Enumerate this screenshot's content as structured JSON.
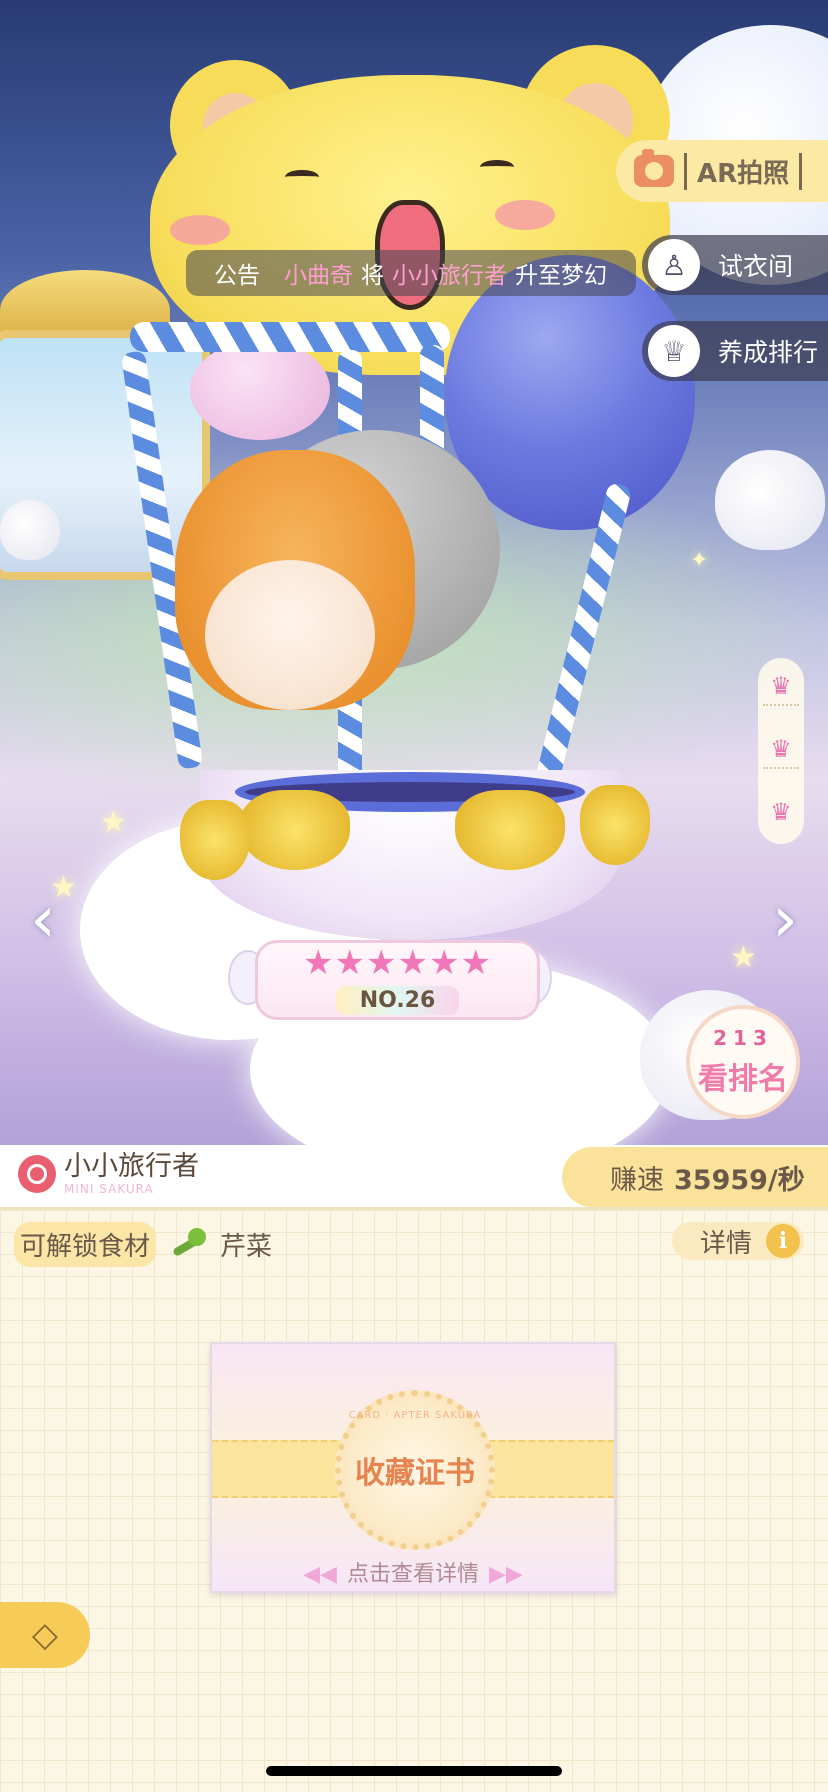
{
  "announcement": {
    "label": "公告",
    "player": "小曲奇",
    "connector": "将",
    "item": "小小旅行者",
    "suffix": "升至梦幻"
  },
  "buttons": {
    "ar_photo": "AR拍照",
    "fitting_room": "试衣间",
    "training_rank": "养成排行",
    "view_rank": "看排名",
    "details": "详情"
  },
  "rank_podium": [
    "2",
    "1",
    "3"
  ],
  "item_card": {
    "stars": "★★★★★★",
    "star_count": 6,
    "number": "NO.26"
  },
  "item": {
    "name": "小小旅行者",
    "name_en": "MINI SAKURA",
    "speed_label": "赚速",
    "speed_value": "35959/秒"
  },
  "ingredients": {
    "label": "可解锁食材",
    "name": "芹菜"
  },
  "certificate": {
    "arc_text": "CARD · APTER SAKURA",
    "title": "收藏证书",
    "hint": "点击查看详情",
    "arrow_left": "◀◀",
    "arrow_right": "▶▶"
  },
  "crowns": [
    "♛",
    "♛",
    "♛"
  ],
  "nav": {
    "prev": "‹",
    "next": "›"
  },
  "back_icon": "◇",
  "colors": {
    "accent_yellow": "#fbe29a",
    "accent_pink": "#f07aa8",
    "announce_pink": "#ff9fcf"
  }
}
